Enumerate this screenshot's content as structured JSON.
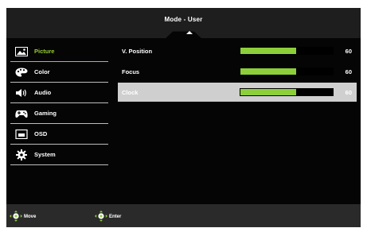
{
  "header": {
    "title": "Mode - User"
  },
  "menu": {
    "items": [
      {
        "label": "Picture",
        "icon": "picture-icon"
      },
      {
        "label": "Color",
        "icon": "color-palette-icon"
      },
      {
        "label": "Audio",
        "icon": "speaker-icon"
      },
      {
        "label": "Gaming",
        "icon": "gamepad-icon"
      },
      {
        "label": "OSD",
        "icon": "osd-icon"
      },
      {
        "label": "System",
        "icon": "gear-icon"
      }
    ],
    "active_index": 0
  },
  "settings": {
    "rows": [
      {
        "label": "V. Position",
        "value": "60",
        "level": 0.6
      },
      {
        "label": "Focus",
        "value": "60",
        "level": 0.6
      },
      {
        "label": "Clock",
        "value": "60",
        "level": 0.6
      }
    ],
    "selected_index": 2
  },
  "footer": {
    "move_label": "Move",
    "enter_label": "Enter"
  },
  "colors": {
    "accent": "#9acd32",
    "bar_fill": "#8ccf3a",
    "selected_row": "#cfcfcf"
  }
}
